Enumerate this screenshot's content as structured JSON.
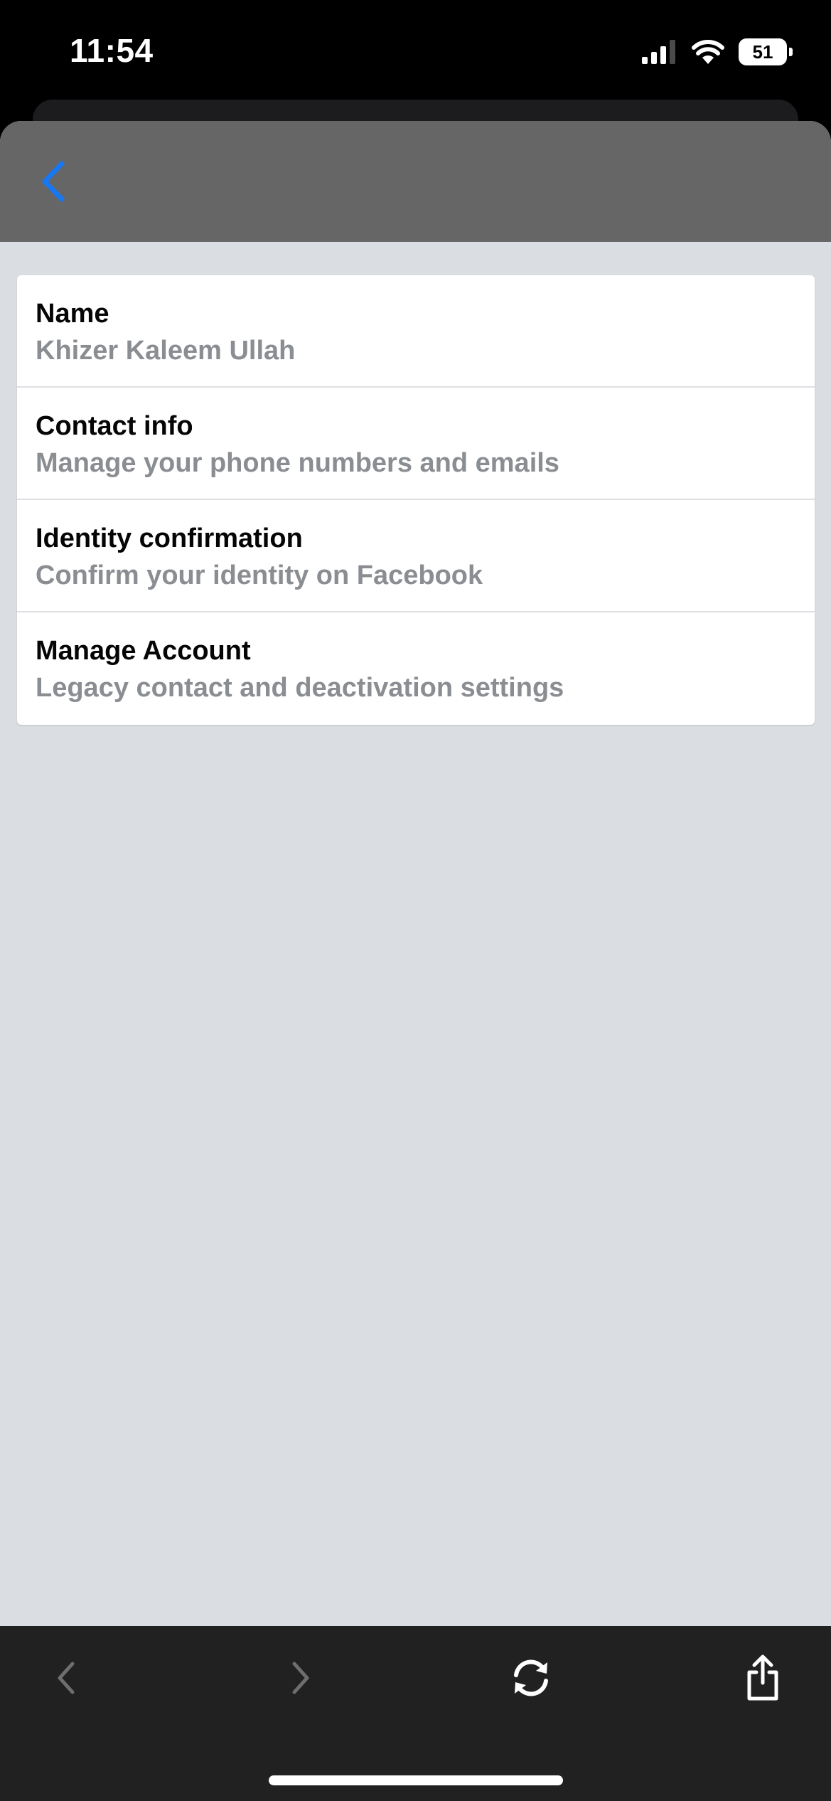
{
  "status_bar": {
    "time": "11:54",
    "battery_level": "51",
    "icons": [
      "cellular-signal-icon",
      "wifi-icon",
      "battery-icon"
    ]
  },
  "header": {
    "back_icon": "chevron-left-icon"
  },
  "settings": {
    "items": [
      {
        "title": "Name",
        "subtitle": "Khizer Kaleem Ullah"
      },
      {
        "title": "Contact info",
        "subtitle": "Manage your phone numbers and emails"
      },
      {
        "title": "Identity confirmation",
        "subtitle": "Confirm your identity on Facebook"
      },
      {
        "title": "Manage Account",
        "subtitle": "Legacy contact and deactivation settings"
      }
    ]
  },
  "toolbar": {
    "icons": [
      "back-arrow-icon",
      "forward-arrow-icon",
      "reload-icon",
      "share-icon"
    ]
  },
  "colors": {
    "accent": "#1877f2",
    "page_background": "#dadde1",
    "header_background": "#666666",
    "toolbar_background": "#212121",
    "subtitle_text": "#8a8d91"
  }
}
